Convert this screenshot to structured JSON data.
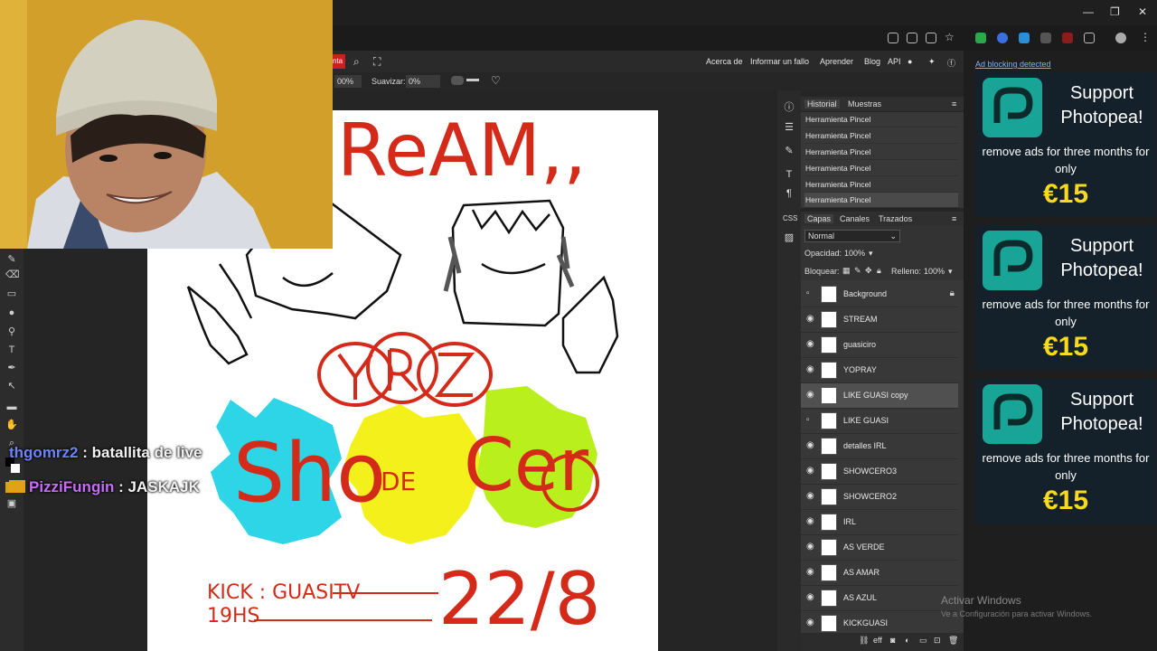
{
  "menu": {
    "tab_partial": "nta",
    "links": [
      "Acerca de",
      "Informar un fallo",
      "Aprender",
      "Blog",
      "API"
    ]
  },
  "options": {
    "opacity_partial": "00%",
    "smooth_label": "Suavizar:",
    "smooth_value": "0%"
  },
  "chat": [
    {
      "user": "thgomrz2",
      "sep": " : ",
      "message": "batallita de live"
    },
    {
      "user": "PizziFungin",
      "sep": " : ",
      "message": "JASKAJK"
    }
  ],
  "history": {
    "tabs": [
      "Historial",
      "Muestras"
    ],
    "items": [
      "Herramienta Pincel",
      "Herramienta Pincel",
      "Herramienta Pincel",
      "Herramienta Pincel",
      "Herramienta Pincel",
      "Herramienta Pincel"
    ]
  },
  "layers": {
    "tabs": [
      "Capas",
      "Canales",
      "Trazados"
    ],
    "blend_mode": "Normal",
    "opacity_label": "Opacidad:",
    "opacity_value": "100%",
    "lock_label": "Bloquear:",
    "fill_label": "Relleno:",
    "fill_value": "100%",
    "items": [
      {
        "name": "Background",
        "visible": false,
        "locked": true
      },
      {
        "name": "STREAM",
        "visible": true
      },
      {
        "name": "guasiciro",
        "visible": true
      },
      {
        "name": "YOPRAY",
        "visible": true
      },
      {
        "name": "LIKE GUASI copy",
        "visible": true,
        "selected": true
      },
      {
        "name": "LIKE GUASI",
        "visible": false
      },
      {
        "name": "detalles IRL",
        "visible": true
      },
      {
        "name": "SHOWCERO3",
        "visible": true
      },
      {
        "name": "SHOWCERO2",
        "visible": true
      },
      {
        "name": "IRL",
        "visible": true
      },
      {
        "name": "AS VERDE",
        "visible": true
      },
      {
        "name": "AS AMAR",
        "visible": true
      },
      {
        "name": "AS AZUL",
        "visible": true
      },
      {
        "name": "KICKGUASI",
        "visible": true
      }
    ]
  },
  "ads": {
    "blocking_notice": "Ad blocking detected",
    "cards": [
      {
        "title": "Support Photopea!",
        "line": "remove ads for three months for only",
        "price": "€15"
      },
      {
        "title": "Support Photopea!",
        "line": "remove ads for three months for only",
        "price": "€15"
      },
      {
        "title": "Support Photopea!",
        "line": "remove ads for three months for only",
        "price": "€15"
      }
    ]
  },
  "artwork": {
    "top_text": "ReAM,,",
    "left_text": "KICK : GUASITV",
    "time_text": "19HS",
    "date_text": "22/8",
    "show_text": "Sho",
    "de_text": "DE",
    "cero_text": "Cer"
  },
  "windows": {
    "activate_title": "Activar Windows",
    "activate_sub": "Ve a Configuración para activar Windows."
  },
  "colors": {
    "accent_red": "#d42a1a",
    "cyan": "#2ed5e6",
    "yellow": "#f4f01b",
    "green": "#b8ef1c",
    "ad_price": "#f7d91d",
    "photopea_teal": "#18a497"
  }
}
